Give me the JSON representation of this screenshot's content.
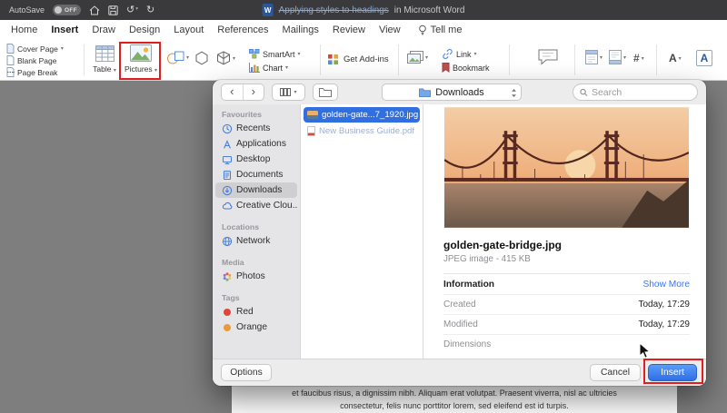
{
  "colors": {
    "accent_blue": "#2f6fe0",
    "insert_button_blue": "#2e6ee6",
    "annotation_red": "#e01e1e",
    "tag_red": "#e0443a",
    "tag_orange": "#e89a3c"
  },
  "icons": {
    "word_doc_glyph": "W",
    "undo": "↺",
    "redo": "↻",
    "dropdown": "▾",
    "back": "‹",
    "forward": "›",
    "page_number": "#",
    "textbox": "A"
  },
  "titlebar": {
    "autosave_label": "AutoSave",
    "autosave_state": "OFF",
    "doc_title_main": "Applying styles to headings",
    "doc_title_suffix": "in Microsoft Word"
  },
  "tabs": {
    "items": [
      {
        "label": "Home"
      },
      {
        "label": "Insert"
      },
      {
        "label": "Draw"
      },
      {
        "label": "Design"
      },
      {
        "label": "Layout"
      },
      {
        "label": "References"
      },
      {
        "label": "Mailings"
      },
      {
        "label": "Review"
      },
      {
        "label": "View"
      }
    ],
    "tell_me": "Tell me"
  },
  "ribbon": {
    "cover_page": "Cover Page",
    "blank_page": "Blank Page",
    "page_break": "Page Break",
    "table": "Table",
    "pictures": "Pictures",
    "smartart": "SmartArt",
    "chart": "Chart",
    "get_addins": "Get Add-ins",
    "link": "Link",
    "bookmark": "Bookmark"
  },
  "dialog": {
    "toolbar": {
      "location": "Downloads",
      "search_placeholder": "Search"
    },
    "sidebar": {
      "favourites_header": "Favourites",
      "favourites": [
        "Recents",
        "Applications",
        "Desktop",
        "Documents",
        "Downloads",
        "Creative Clou..."
      ],
      "locations_header": "Locations",
      "locations": [
        "Network"
      ],
      "media_header": "Media",
      "media": [
        "Photos"
      ],
      "tags_header": "Tags",
      "tags": [
        "Red",
        "Orange"
      ]
    },
    "files": [
      {
        "name": "golden-gate...7_1920.jpg"
      },
      {
        "name": "New Business Guide.pdf"
      }
    ],
    "preview": {
      "filename": "golden-gate-bridge.jpg",
      "meta": "JPEG image - 415 KB",
      "information_label": "Information",
      "show_more_label": "Show More",
      "rows": [
        {
          "label": "Created",
          "value": "Today, 17:29"
        },
        {
          "label": "Modified",
          "value": "Today, 17:29"
        },
        {
          "label": "Dimensions",
          "value": ""
        }
      ]
    },
    "buttons": {
      "options": "Options",
      "cancel": "Cancel",
      "insert": "Insert"
    }
  },
  "document": {
    "line1": "et faucibus risus, a dignissim nibh. Aliquam erat volutpat. Praesent viverra, nisl ac ultricies",
    "line2": "consectetur, felis nunc porttitor lorem, sed eleifend est id turpis."
  }
}
